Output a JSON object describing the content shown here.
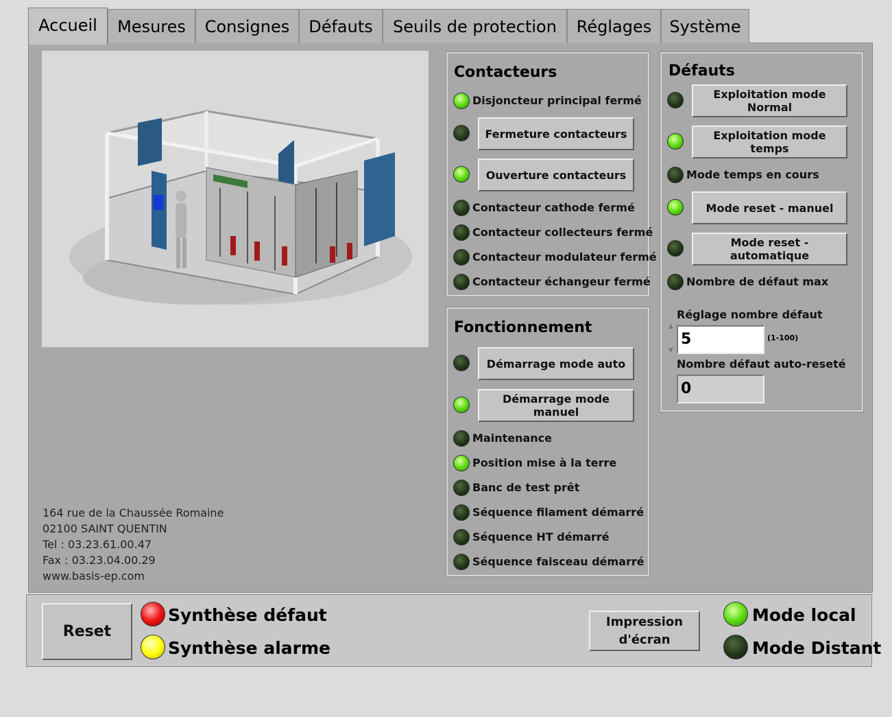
{
  "tabs": [
    "Accueil",
    "Mesures",
    "Consignes",
    "Défauts",
    "Seuils de protection",
    "Réglages",
    "Système"
  ],
  "address": {
    "line1": "164 rue de la Chaussée Romaine",
    "line2": "02100 SAINT QUENTIN",
    "line3": "Tel : 03.23.61.00.47",
    "line4": "Fax : 03.23.04.00.29",
    "line5": "www.basis-ep.com"
  },
  "contacteurs": {
    "title": "Contacteurs",
    "disjoncteur": "Disjoncteur principal fermé",
    "fermeture_btn": "Fermeture contacteurs",
    "ouverture_btn": "Ouverture contacteurs",
    "cathode": "Contacteur cathode fermé",
    "collecteurs": "Contacteur collecteurs fermé",
    "modulateur": "Contacteur modulateur fermé",
    "echangeur": "Contacteur échangeur fermé"
  },
  "fonctionnement": {
    "title": "Fonctionnement",
    "auto_btn": "Démarrage mode auto",
    "manuel_btn": "Démarrage mode manuel",
    "maintenance": "Maintenance",
    "terre": "Position mise à la terre",
    "banc": "Banc de test prêt",
    "filament": "Séquence filament démarré",
    "ht": "Séquence HT démarré",
    "faisceau": "Séquence faisceau démarré"
  },
  "defauts": {
    "title": "Défauts",
    "normal_btn": "Exploitation mode Normal",
    "temps_btn": "Exploitation mode temps",
    "temps_cours": "Mode temps en cours",
    "reset_manuel_btn": "Mode reset - manuel",
    "reset_auto_btn": "Mode reset - automatique",
    "defaut_max": "Nombre de défaut max",
    "reglage_label": "Réglage nombre défaut",
    "reglage_value": "5",
    "reglage_range": "(1-100)",
    "auto_reset_label": "Nombre défaut auto-reseté",
    "auto_reset_value": "0"
  },
  "bottom": {
    "reset": "Reset",
    "synthese_defaut": "Synthèse défaut",
    "synthese_alarme": "Synthèse alarme",
    "impression_line1": "Impression",
    "impression_line2": "d'écran",
    "mode_local": "Mode local",
    "mode_distant": "Mode Distant"
  }
}
